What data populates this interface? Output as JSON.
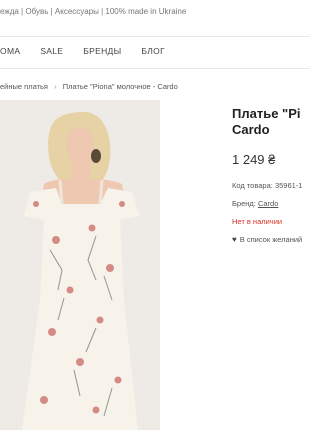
{
  "header": {
    "tagline": "ежда | Обувь | Аксессуары | 100% made in Ukraine"
  },
  "nav": {
    "items": [
      "ДОМА",
      "SALE",
      "БРЕНДЫ",
      "БЛОГ"
    ]
  },
  "breadcrumb": {
    "items": [
      "ейные платья",
      "Платье \"Piona\" молочное - Cardo"
    ],
    "separator": "›"
  },
  "product": {
    "title_line1": "Платье \"Pi",
    "title_line2": "Cardo",
    "price": "1 249 ₴",
    "code_label": "Код товара: 35961-1",
    "brand_label": "Бренд: ",
    "brand_value": "Cardo",
    "stock": "Нет в наличии",
    "wishlist": "В список желаний"
  },
  "colors": {
    "stock": "#d93025",
    "dress": "#f7f2ea",
    "hair": "#e6d2a4"
  }
}
